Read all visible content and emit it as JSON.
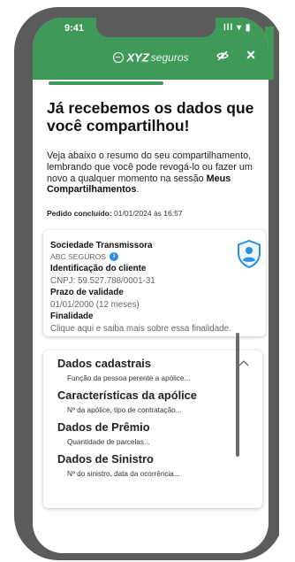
{
  "status": {
    "time": "9:41",
    "icons": "lll ▾ ▮"
  },
  "brand": {
    "name": "XYZ",
    "suffix": "seguros"
  },
  "colors": {
    "primary": "#3f9a59",
    "info": "#2d8fe0",
    "frame": "#5b5b5b"
  },
  "icons": {
    "close": "×",
    "shield": "shield-person-icon",
    "eye": "eye-off-icon",
    "chevron": "chevron-up-icon"
  },
  "progress": {
    "fraction": 0.5
  },
  "title": "Já recebemos os dados que você compartilhou!",
  "intro": {
    "text": "Veja abaixo o resumo do seu compartilhamento, lembrando que você pode revogá-lo ou fazer um novo a qualquer momento na sessão ",
    "bold": "Meus Compartilhamentos",
    "end": "."
  },
  "order": {
    "label": "Pedido concluído:",
    "value": "01/01/2024 às 16:57"
  },
  "summary": {
    "transmitter_label": "Sociedade Transmissora",
    "transmitter_value": "ABC SEGUROS",
    "client_label": "Identificação do cliente",
    "client_value": "CNPJ: 59.527.788/0001-31",
    "validity_label": "Prazo de validade",
    "validity_value": "01/01/2000 (12 meses)",
    "purpose_label": "Finalidade",
    "purpose_value": "Clique aqui e saiba mais sobre essa finalidade."
  },
  "details": [
    {
      "title": "Dados cadastrais",
      "desc": "Função da pessoa perente a apólice..."
    },
    {
      "title": "Características da apólice",
      "desc": "Nº da apólice, tipo de contratação..."
    },
    {
      "title": "Dados de Prêmio",
      "desc": "Quantidade de parcelas..."
    },
    {
      "title": "Dados de Sinistro",
      "desc": "Nº do sinistro, data da ocorrência..."
    }
  ]
}
